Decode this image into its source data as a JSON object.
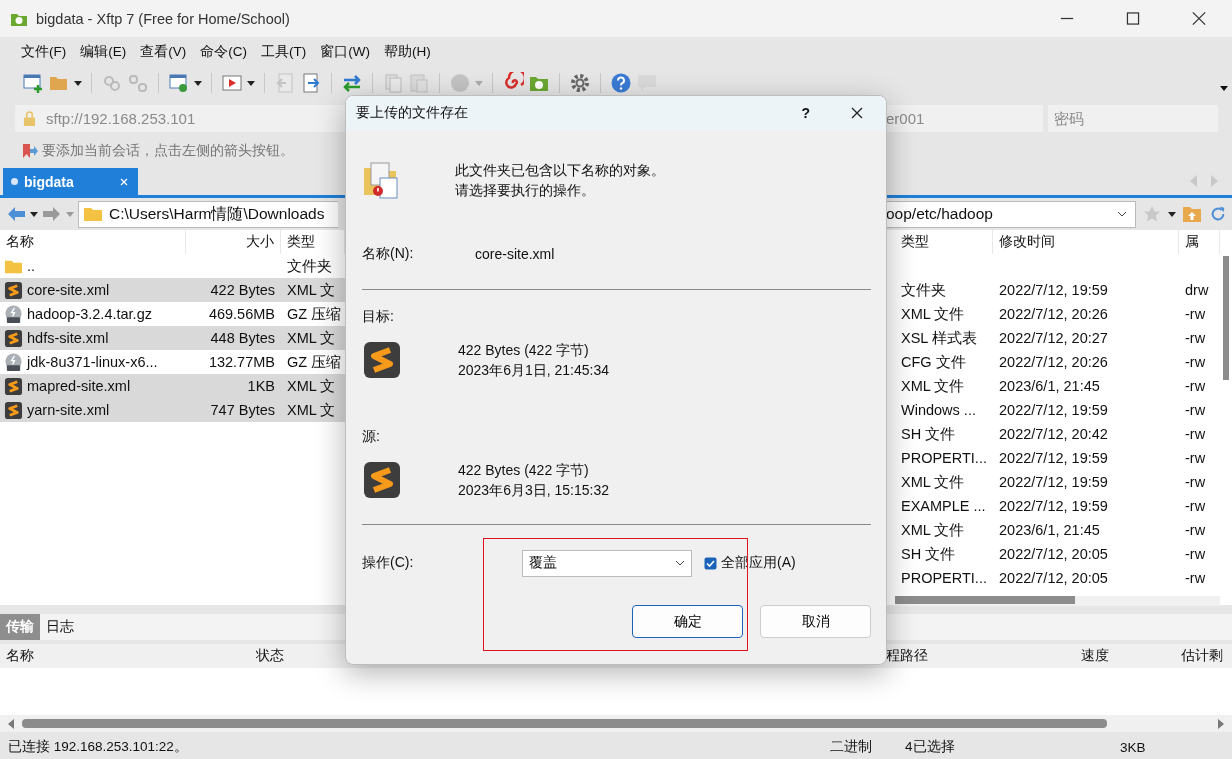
{
  "window": {
    "title": "bigdata - Xftp 7 (Free for Home/School)"
  },
  "menu": [
    "文件(F)",
    "编辑(E)",
    "查看(V)",
    "命令(C)",
    "工具(T)",
    "窗口(W)",
    "帮助(H)"
  ],
  "address": {
    "url": "sftp://192.168.253.101",
    "user": "er001",
    "password_placeholder": "密码"
  },
  "hint": "要添加当前会话，点击左侧的箭头按钮。",
  "session_tabs": [
    {
      "label": "bigdata",
      "selected": true
    }
  ],
  "local": {
    "path": "C:\\Users\\Harm情随\\Downloads",
    "columns": [
      "名称",
      "大小",
      "类型"
    ],
    "rows": [
      {
        "kind": "folder",
        "name": "..",
        "type": "文件夹",
        "selected": false
      },
      {
        "kind": "xml",
        "name": "core-site.xml",
        "size": "422 Bytes",
        "type": "XML 文",
        "selected": true
      },
      {
        "kind": "gz",
        "name": "hadoop-3.2.4.tar.gz",
        "size": "469.56MB",
        "type": "GZ 压缩",
        "selected": false
      },
      {
        "kind": "xml",
        "name": "hdfs-site.xml",
        "size": "448 Bytes",
        "type": "XML 文",
        "selected": true
      },
      {
        "kind": "gz",
        "name": "jdk-8u371-linux-x6...",
        "size": "132.77MB",
        "type": "GZ 压缩",
        "selected": false
      },
      {
        "kind": "xml",
        "name": "mapred-site.xml",
        "size": "1KB",
        "type": "XML 文",
        "selected": true
      },
      {
        "kind": "xml",
        "name": "yarn-site.xml",
        "size": "747 Bytes",
        "type": "XML 文",
        "selected": true
      }
    ]
  },
  "remote": {
    "path": "oop/etc/hadoop",
    "columns": [
      "类型",
      "修改时间",
      "属"
    ],
    "rows": [
      {
        "type": "文件夹",
        "modified": "2022/7/12, 19:59",
        "attr": "drw"
      },
      {
        "type": "XML 文件",
        "modified": "2022/7/12, 20:26",
        "attr": "-rw"
      },
      {
        "type": "XSL 样式表",
        "modified": "2022/7/12, 20:27",
        "attr": "-rw"
      },
      {
        "type": "CFG 文件",
        "modified": "2022/7/12, 20:26",
        "attr": "-rw"
      },
      {
        "type": "XML 文件",
        "modified": "2023/6/1, 21:45",
        "attr": "-rw"
      },
      {
        "type": "Windows ...",
        "modified": "2022/7/12, 19:59",
        "attr": "-rw"
      },
      {
        "type": "SH 文件",
        "modified": "2022/7/12, 20:42",
        "attr": "-rw"
      },
      {
        "type": "PROPERTI...",
        "modified": "2022/7/12, 19:59",
        "attr": "-rw"
      },
      {
        "type": "XML 文件",
        "modified": "2022/7/12, 19:59",
        "attr": "-rw"
      },
      {
        "type": "EXAMPLE ...",
        "modified": "2022/7/12, 19:59",
        "attr": "-rw"
      },
      {
        "type": "XML 文件",
        "modified": "2023/6/1, 21:45",
        "attr": "-rw"
      },
      {
        "type": "SH 文件",
        "modified": "2022/7/12, 20:05",
        "attr": "-rw"
      },
      {
        "type": "PROPERTI...",
        "modified": "2022/7/12, 20:05",
        "attr": "-rw"
      }
    ]
  },
  "dialog": {
    "title": "要上传的文件存在",
    "help": "?",
    "message": [
      "此文件夹已包含以下名称的对象。",
      "请选择要执行的操作。"
    ],
    "name_label": "名称(N):",
    "name": "core-site.xml",
    "target": {
      "label": "目标:",
      "size": "422 Bytes (422 字节)",
      "date": "2023年6月1日, 21:45:34"
    },
    "source": {
      "label": "源:",
      "size": "422 Bytes (422 字节)",
      "date": "2023年6月3日, 15:15:32"
    },
    "action_label": "操作(C):",
    "action": "覆盖",
    "apply_all": {
      "label": "全部应用(A)",
      "checked": true
    },
    "buttons": [
      {
        "label": "确定",
        "default": true
      },
      {
        "label": "取消",
        "default": false
      }
    ]
  },
  "bottom_tabs": [
    {
      "label": "传输",
      "selected": true
    },
    {
      "label": "日志",
      "selected": false
    }
  ],
  "transfer_columns": [
    "名称",
    "状态",
    "程路径",
    "速度",
    "估计剩"
  ],
  "status_bar": {
    "connection": "已连接 192.168.253.101:22。",
    "mode": "二进制",
    "selection": "4已选择",
    "size": "3KB"
  }
}
